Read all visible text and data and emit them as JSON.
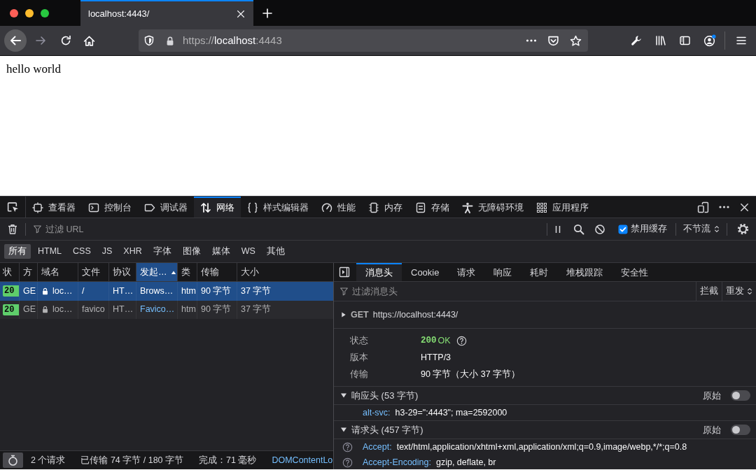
{
  "browser": {
    "tabs": [
      {
        "title": "localhost:4443/",
        "selected": true
      }
    ],
    "address": {
      "scheme": "https://",
      "host": "localhost",
      "port": ":4443"
    }
  },
  "page": {
    "text": "hello world"
  },
  "devtools": {
    "tools": [
      {
        "label": "查看器",
        "selected": false
      },
      {
        "label": "控制台",
        "selected": false
      },
      {
        "label": "调试器",
        "selected": false
      },
      {
        "label": "网络",
        "selected": true
      },
      {
        "label": "样式编辑器",
        "selected": false
      },
      {
        "label": "性能",
        "selected": false
      },
      {
        "label": "内存",
        "selected": false
      },
      {
        "label": "存储",
        "selected": false
      },
      {
        "label": "无障碍环境",
        "selected": false
      },
      {
        "label": "应用程序",
        "selected": false
      }
    ],
    "url_filter": {
      "placeholder": "过滤 URL"
    },
    "disable_cache": {
      "label": "禁用缓存",
      "checked": true
    },
    "throttling": {
      "value": "不节流"
    },
    "type_filters": [
      {
        "label": "所有",
        "selected": true
      },
      {
        "label": "HTML",
        "selected": false
      },
      {
        "label": "CSS",
        "selected": false
      },
      {
        "label": "JS",
        "selected": false
      },
      {
        "label": "XHR",
        "selected": false
      },
      {
        "label": "字体",
        "selected": false
      },
      {
        "label": "图像",
        "selected": false
      },
      {
        "label": "媒体",
        "selected": false
      },
      {
        "label": "WS",
        "selected": false
      },
      {
        "label": "其他",
        "selected": false
      }
    ],
    "requests": {
      "columns": [
        {
          "label": "状",
          "sorted": false
        },
        {
          "label": "方",
          "sorted": false
        },
        {
          "label": "域名",
          "sorted": false
        },
        {
          "label": "文件",
          "sorted": false
        },
        {
          "label": "协议",
          "sorted": false
        },
        {
          "label": "发起…",
          "sorted": true
        },
        {
          "label": "类",
          "sorted": false
        },
        {
          "label": "传输",
          "sorted": false
        },
        {
          "label": "大小",
          "sorted": false
        }
      ],
      "rows": [
        {
          "selected": true,
          "status": "20",
          "method": "GE",
          "domain": "loc…",
          "file": "/",
          "protocol": "HT…",
          "initiator": "Brows…",
          "initiator_link": false,
          "type": "htm",
          "transferred": "90 字节",
          "size": "37 字节"
        },
        {
          "selected": false,
          "status": "20",
          "method": "GE",
          "domain": "loc…",
          "file": "favico",
          "protocol": "HT…",
          "initiator": "Favico…",
          "initiator_link": true,
          "type": "htm",
          "transferred": "90 字节",
          "size": "37 字节"
        }
      ]
    },
    "status_bar": {
      "requests": "2 个请求",
      "transferred": "已传输 74 字节 / 180 字节",
      "finish": "完成：71 毫秒",
      "dom_content_loaded": "DOMContentLo"
    },
    "details": {
      "tabs": [
        {
          "label": "消息头",
          "selected": true
        },
        {
          "label": "Cookie",
          "selected": false
        },
        {
          "label": "请求",
          "selected": false
        },
        {
          "label": "响应",
          "selected": false
        },
        {
          "label": "耗时",
          "selected": false
        },
        {
          "label": "堆栈跟踪",
          "selected": false
        },
        {
          "label": "安全性",
          "selected": false
        }
      ],
      "filter": {
        "placeholder": "过滤消息头"
      },
      "actions": [
        "拦截",
        "重发"
      ],
      "request_line": {
        "expanded": false,
        "method": "GET",
        "url": "https://localhost:4443/"
      },
      "summary": [
        {
          "label": "状态",
          "code": "200",
          "value": "OK"
        },
        {
          "label": "版本",
          "value": "HTTP/3"
        },
        {
          "label": "传输",
          "value": "90 字节（大小 37 字节）"
        }
      ],
      "sections": [
        {
          "title": "响应头 (53 字节)",
          "expanded": true,
          "raw_label": "原始",
          "raw": false,
          "headers": [
            {
              "name": "alt-svc:",
              "value": "h3-29=\":4443\"; ma=2592000",
              "help": false
            }
          ]
        },
        {
          "title": "请求头 (457 字节)",
          "expanded": true,
          "raw_label": "原始",
          "raw": false,
          "headers": [
            {
              "name": "Accept:",
              "value": "text/html,application/xhtml+xml,application/xml;q=0.9,image/webp,*/*;q=0.8",
              "help": true
            },
            {
              "name": "Accept-Encoding:",
              "value": "gzip, deflate, br",
              "help": true
            }
          ]
        }
      ]
    }
  }
}
